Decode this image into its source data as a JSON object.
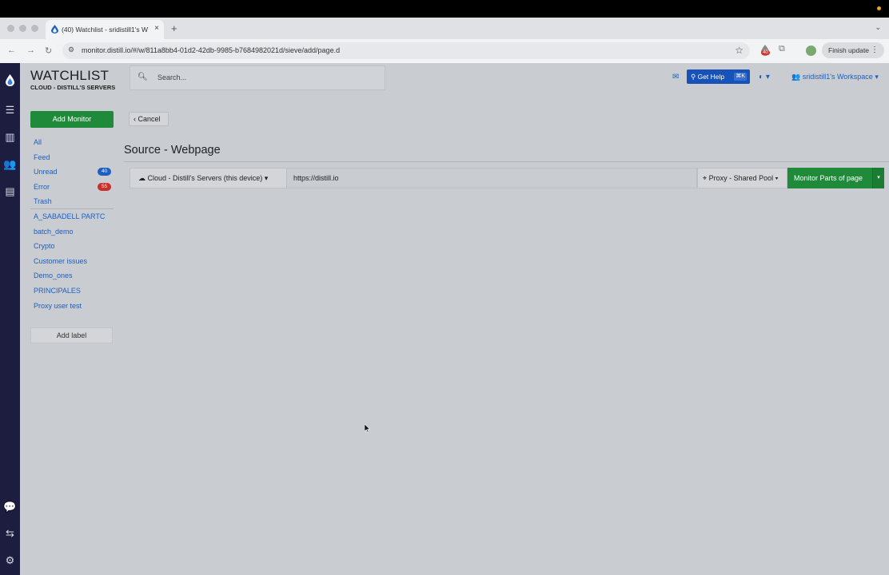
{
  "browser": {
    "tab_title": "(40) Watchlist - sridistill1's W",
    "tab_close": "×",
    "new_tab": "+",
    "url": "monitor.distill.io/#/w/811a8bb4-01d2-42db-9985-b7684982021d/sieve/add/page.d",
    "extension_badge": "40",
    "finish_update_label": "Finish update",
    "icons": [
      "back-icon",
      "forward-icon",
      "reload-icon",
      "site-info-icon",
      "star-icon",
      "extension-icon",
      "puzzle-icon",
      "profile-avatar",
      "menu-icon"
    ]
  },
  "brand": {
    "title": "WATCHLIST",
    "subtitle": "CLOUD - DISTILL'S SERVERS"
  },
  "header": {
    "search_placeholder": "Search...",
    "get_help_label": "Get Help",
    "get_help_shortcut": "⌘K",
    "workspace_label": "sridistill1's Workspace"
  },
  "sidebar": {
    "add_monitor_label": "Add Monitor",
    "nav": [
      {
        "label": "All"
      },
      {
        "label": "Feed"
      },
      {
        "label": "Unread",
        "badge": "40",
        "badge_color": "#1e5fbf"
      },
      {
        "label": "Error",
        "badge": "55",
        "badge_color": "#c9302c"
      },
      {
        "label": "Trash"
      }
    ],
    "labels": [
      {
        "label": "A_SABADELL PARTC"
      },
      {
        "label": "batch_demo"
      },
      {
        "label": "Crypto"
      },
      {
        "label": "Customer issues"
      },
      {
        "label": "Demo_ones"
      },
      {
        "label": "PRINCIPALES"
      },
      {
        "label": "Proxy user test"
      }
    ],
    "add_label_button": "Add label"
  },
  "main": {
    "cancel_label": "Cancel",
    "page_title": "Source - Webpage",
    "device_select_label": "Cloud - Distill's Servers (this device)",
    "url_value": "https://distill.io",
    "proxy_label": "Proxy - Shared Pool",
    "monitor_parts_label": "Monitor Parts of page"
  },
  "colors": {
    "rail_bg": "#1c1d3f",
    "accent_blue": "#1e5fbf",
    "primary_green": "#1e8a3a",
    "error_red": "#c9302c"
  }
}
